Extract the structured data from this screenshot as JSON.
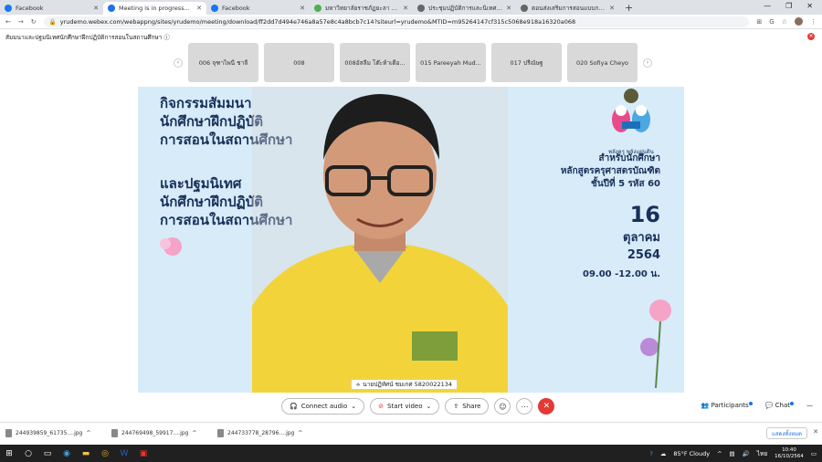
{
  "browser": {
    "tabs": [
      {
        "label": "Facebook",
        "color": "#1877f2",
        "active": false
      },
      {
        "label": "Meeting is in progress...",
        "color": "#1a73e8",
        "active": true
      },
      {
        "label": "Facebook",
        "color": "#1877f2",
        "active": false
      },
      {
        "label": "มหาวิทยาลัยราชภัฏยะลา - ระบบสารสนเ...",
        "color": "#4caf50",
        "active": false
      },
      {
        "label": "ประชุมปฏิบัติการและนิเทศนักศึกษา โคร...",
        "color": "#666666",
        "active": false
      },
      {
        "label": "ตอนส่งเสริมการสอนแบบการเรียนรู้ ...",
        "color": "#666666",
        "active": false
      }
    ],
    "url": "yrudemo.webex.com/webappng/sites/yrudemo/meeting/download/ff2dd7d494e746a8a57e8c4a8bcb7c14?siteurl=yrudemo&MTID=m95264147cf315c5068e918a16320a068"
  },
  "meeting": {
    "title": "สัมมนาและปฐมนิเทศนักศึกษาฝึกปฏิบัติการสอนในสถานศึกษา ⓘ",
    "participants": [
      "006 จุฑาไพนี ชาลี",
      "008",
      "008อัสลีม โต๊ะห้าเดือ...",
      "015 Pareeyah Mud...",
      "017 ปรีณัษฐ",
      "020 Sofiya Cheyo"
    ],
    "speaker_name": "นายปฏิทัศน์ ชมเกศ 5820022134",
    "poster": {
      "left_lines_1": [
        "กิจกรรมสัมมนา",
        "นักศึกษาฝึกปฏิบัติ",
        "การสอนในสถานศึกษา"
      ],
      "left_lines_2": [
        "และปฐมนิเทศ",
        "นักศึกษาฝึกปฏิบัติ",
        "การสอนในสถานศึกษา"
      ],
      "logo_text": "พลังครู พลังแผ่นดิน",
      "right_lines": [
        "สำหรับนักศึกษา",
        "หลักสูตรครุศาสตรบัณฑิต",
        "ชั้นปีที่ 5 รหัส 60"
      ],
      "day": "16",
      "month": "ตุลาคม",
      "year": "2564",
      "time": "09.00 -12.00 น."
    }
  },
  "controls": {
    "connect_audio": "Connect audio",
    "start_video": "Start video",
    "share": "Share",
    "participants": "Participants",
    "chat": "Chat"
  },
  "downloads": {
    "items": [
      "244939859_61735....jpg",
      "244769498_59917....jpg",
      "244733778_28796....jpg"
    ],
    "show_all": "แสดงทั้งหมด"
  },
  "taskbar": {
    "weather": "85°F Cloudy",
    "lang": "ไทย",
    "time": "10:40",
    "date": "16/10/2564"
  }
}
